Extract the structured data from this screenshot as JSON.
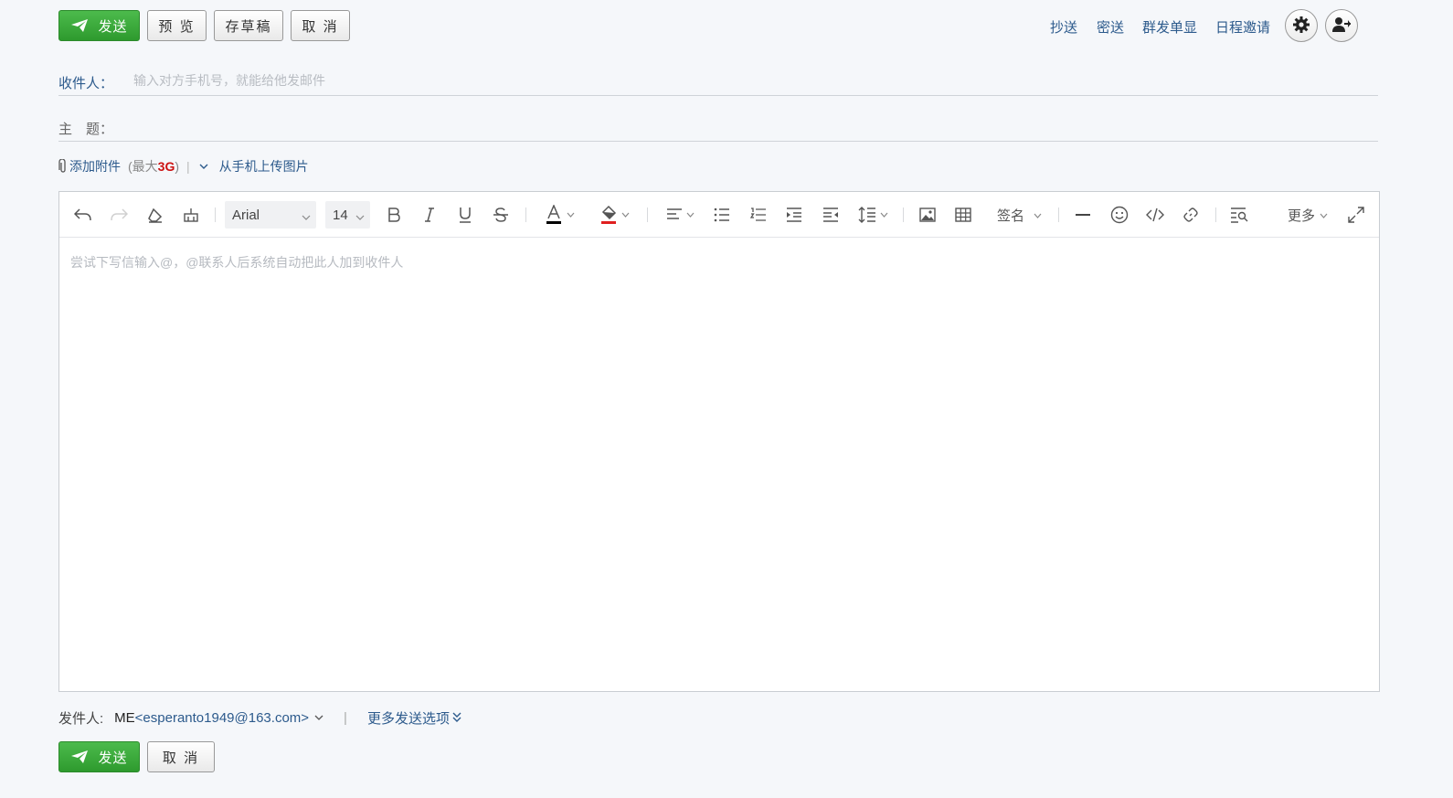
{
  "toolbar_top": {
    "send_label": "发送",
    "preview_label": "预 览",
    "draft_label": "存草稿",
    "cancel_label": "取 消"
  },
  "top_links": {
    "cc": "抄送",
    "bcc": "密送",
    "group_send": "群发单显",
    "calendar_invite": "日程邀请"
  },
  "recipient": {
    "label": "收件人：",
    "placeholder": "输入对方手机号，就能给他发邮件",
    "value": ""
  },
  "subject": {
    "label": "主　题：",
    "value": ""
  },
  "attachment": {
    "add_label": "添加附件",
    "limit_prefix": "(最大",
    "limit_value": "3G",
    "limit_suffix": ")",
    "separator": "|",
    "upload_phone_label": "从手机上传图片"
  },
  "editor_toolbar": {
    "font_family": "Arial",
    "font_size": "14",
    "signature_label": "签名",
    "more_label": "更多"
  },
  "editor": {
    "placeholder": "尝试下写信输入@，@联系人后系统自动把此人加到收件人"
  },
  "sender": {
    "label": "发件人:",
    "name": "ME",
    "email": "<esperanto1949@163.com>",
    "separator": "|",
    "more_options_label": "更多发送选项"
  },
  "toolbar_bottom": {
    "send_label": "发送",
    "cancel_label": "取 消"
  },
  "colors": {
    "send_green": "#3aa63a",
    "link_blue": "#2c5a8c",
    "limit_red": "#cc1111",
    "font_color_bar": "#000000",
    "highlight_bar": "#e02020"
  }
}
